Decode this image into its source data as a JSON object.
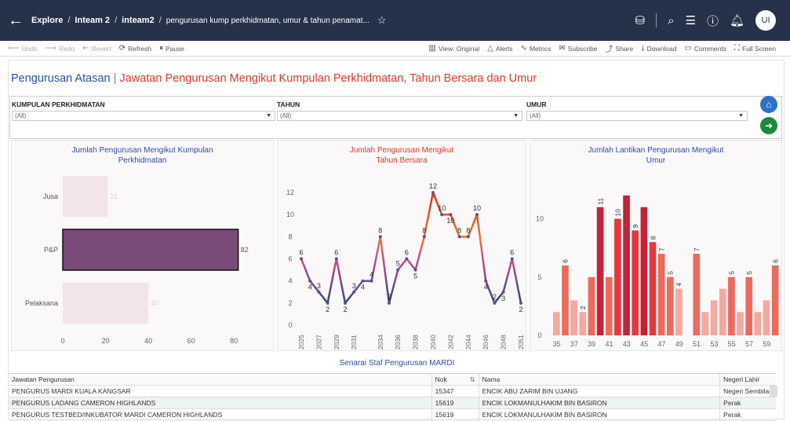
{
  "topbar": {
    "breadcrumb": [
      "Explore",
      "Inteam 2",
      "inteam2"
    ],
    "current": "pengurusan kump perkhidmatan, umur & tahun penamat...",
    "avatar": "UI"
  },
  "toolbar": {
    "left": [
      {
        "label": "Undo",
        "icon": "undo-icon",
        "disabled": true
      },
      {
        "label": "Redo",
        "icon": "redo-icon",
        "disabled": true
      },
      {
        "label": "Revert",
        "icon": "revert-icon",
        "disabled": true
      },
      {
        "label": "Refresh",
        "icon": "refresh-icon",
        "disabled": false
      },
      {
        "label": "Pause",
        "icon": "pause-icon",
        "disabled": false
      }
    ],
    "right": [
      {
        "label": "View: Original",
        "icon": "view-icon"
      },
      {
        "label": "Alerts",
        "icon": "alert-icon"
      },
      {
        "label": "Metrics",
        "icon": "metrics-icon"
      },
      {
        "label": "Subscribe",
        "icon": "subscribe-icon"
      },
      {
        "label": "Share",
        "icon": "share-icon"
      },
      {
        "label": "Download",
        "icon": "download-icon"
      },
      {
        "label": "Comments",
        "icon": "comments-icon"
      },
      {
        "label": "Full Screen",
        "icon": "fullscreen-icon"
      }
    ]
  },
  "dashboard": {
    "title_a": "Pengurusan Atasan",
    "title_sep": "|",
    "title_b": "Jawatan Pengurusan Mengikut Kumpulan Perkhidmatan, Tahun Bersara dan Umur"
  },
  "filters": [
    {
      "label": "KUMPULAN PERKHIDMATAN",
      "value": "(All)"
    },
    {
      "label": "TAHUN",
      "value": "(All)"
    },
    {
      "label": "UMUR",
      "value": "(All)"
    }
  ],
  "chart_data": [
    {
      "type": "bar",
      "orientation": "horizontal",
      "title": "Jumlah Pengurusan Mengikut Kumpulan Perkhidmatan",
      "categories": [
        "Jusa",
        "P&P",
        "Pelaksana"
      ],
      "values": [
        21,
        82,
        40
      ],
      "xticks": [
        0,
        20,
        40,
        60,
        80
      ],
      "xlim": [
        0,
        88
      ],
      "colors": {
        "highlight": "#7a4a78",
        "muted": "#f2e4ea",
        "label_muted": "#e8c9d6"
      }
    },
    {
      "type": "line",
      "title": "Jumlah Pengurusan Mengikut Tahun Bersara",
      "x": [
        2025,
        2026,
        2027,
        2028,
        2029,
        2030,
        2031,
        2032,
        2033,
        2034,
        2035,
        2036,
        2037,
        2038,
        2039,
        2040,
        2041,
        2042,
        2043,
        2044,
        2045,
        2046,
        2047,
        2048,
        2049,
        2050,
        2051
      ],
      "values": [
        6,
        4,
        3,
        2,
        6,
        2,
        3,
        4,
        4,
        8,
        2,
        5,
        6,
        5,
        8,
        12,
        10,
        10,
        8,
        8,
        10,
        4,
        2,
        3,
        6,
        2
      ],
      "xticks": [
        2025,
        2027,
        2029,
        2031,
        2034,
        2036,
        2038,
        2040,
        2042,
        2044,
        2046,
        2048,
        2051
      ],
      "yticks": [
        0,
        2,
        4,
        6,
        8,
        10,
        12
      ],
      "ylim": [
        0,
        13
      ]
    },
    {
      "type": "bar",
      "title": "Jumlah Lantikan Pengurusan Mengikut Umur",
      "x": [
        35,
        36,
        37,
        38,
        39,
        40,
        41,
        42,
        43,
        44,
        45,
        46,
        47,
        48,
        49,
        50,
        51,
        52,
        53,
        54,
        55,
        56,
        57,
        58,
        59,
        60
      ],
      "values": [
        2,
        6,
        3,
        2,
        5,
        11,
        5,
        10,
        12,
        9,
        11,
        8,
        7,
        5,
        4,
        0,
        7,
        2,
        3,
        4,
        5,
        2,
        5,
        2,
        3,
        6
      ],
      "labels_shown": [
        36,
        38,
        40,
        42,
        44,
        46,
        47,
        48,
        49,
        51,
        55,
        57,
        60
      ],
      "xticks": [
        35,
        37,
        39,
        41,
        43,
        45,
        47,
        49,
        51,
        53,
        55,
        57,
        59
      ],
      "yticks": [
        0,
        5,
        10
      ],
      "ylim": [
        0,
        13
      ]
    }
  ],
  "table": {
    "title": "Senarai Staf Pengurusan MARDI",
    "columns": [
      "Jawatan Pengurusan",
      "Nok",
      "Nama",
      "Negeri Lahir"
    ],
    "rows": [
      [
        "PENGURUS MARDI KUALA KANGSAR",
        "15347",
        "ENCIK ABU ZARIM BIN UJANG",
        "Negeri Sembilan"
      ],
      [
        "PENGURUS LADANG CAMERON HIGHLANDS",
        "15619",
        "ENCIK LOKMANULHAKIM BIN BASIRON",
        "Perak"
      ],
      [
        "PENGURUS TESTBED/INKUBATOR MARDI CAMERON HIGHLANDS",
        "15619",
        "ENCIK LOKMANULHAKIM BIN BASIRON",
        "Perak"
      ]
    ]
  }
}
